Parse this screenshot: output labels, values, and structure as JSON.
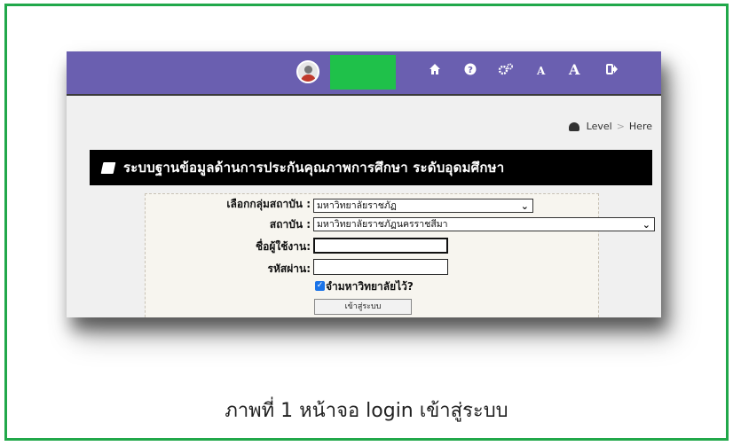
{
  "topbar": {
    "icons": [
      "user-avatar",
      "home-icon",
      "help-icon",
      "settings-icon",
      "font-decrease-icon",
      "font-increase-icon",
      "logout-icon"
    ],
    "font_small_label": "A",
    "font_large_label": "A",
    "bg_color": "#6a5fb0"
  },
  "breadcrumb": {
    "icon": "dashboard-icon",
    "level": "Level",
    "separator": ">",
    "here": "Here"
  },
  "header": {
    "icon": "book-icon",
    "title": "ระบบฐานข้อมูลด้านการประกันคุณภาพการศึกษา ระดับอุดมศึกษา"
  },
  "form": {
    "group_label": "เลือกกลุ่มสถาบัน :",
    "group_value": "มหาวิทยาลัยราชภัฏ",
    "institution_label": "สถาบัน :",
    "institution_value": "มหาวิทยาลัยราชภัฏนครราชสีมา",
    "username_label": "ชื่อผู้ใช้งาน:",
    "username_value": "",
    "password_label": "รหัสผ่าน:",
    "password_value": "",
    "remember_label": "จำมหาวิทยาลัยไว้?",
    "remember_checked": true,
    "login_button": "เข้าสู่ระบบ"
  },
  "caption": "ภาพที่ 1 หน้าจอ login เข้าสู่ระบบ",
  "colors": {
    "frame_border": "#21a84a",
    "redaction": "#1fc14a",
    "title_bar": "#000000"
  }
}
